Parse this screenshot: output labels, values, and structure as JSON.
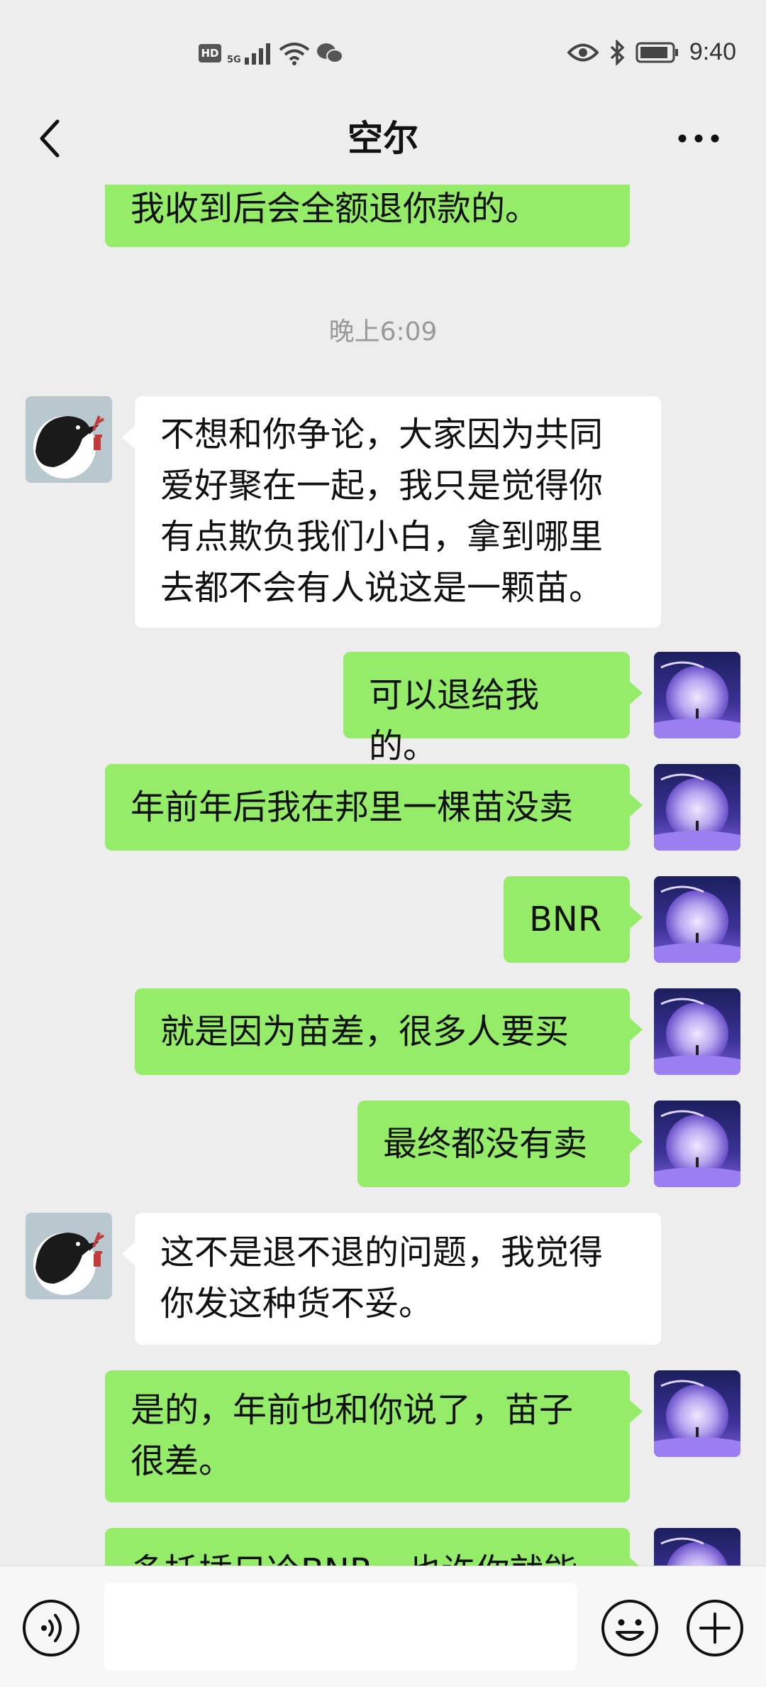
{
  "status_bar": {
    "hd": "HD",
    "network": "5G",
    "time": "9:40",
    "icons": [
      "hd-icon",
      "signal-icon",
      "wifi-icon",
      "wechat-icon",
      "eye-icon",
      "bluetooth-icon",
      "battery-icon"
    ]
  },
  "header": {
    "title": "空尔",
    "back_icon": "chevron-left-icon",
    "more_icon": "more-dots-icon"
  },
  "messages": [
    {
      "side": "right",
      "lines": [
        "我收到后会全额退你款的。"
      ]
    },
    {
      "type": "timestamp",
      "text": "晚上6:09"
    },
    {
      "side": "left",
      "lines": [
        "不想和你争论，大家因为共同",
        "爱好聚在一起，我只是觉得你",
        "有点欺负我们小白，拿到哪里",
        "去都不会有人说这是一颗苗。"
      ]
    },
    {
      "side": "right",
      "lines": [
        "可以退给我的。"
      ]
    },
    {
      "side": "right",
      "lines": [
        "年前年后我在邦里一棵苗没卖"
      ]
    },
    {
      "side": "right",
      "lines": [
        "BNR"
      ]
    },
    {
      "side": "right",
      "lines": [
        "就是因为苗差，很多人要买"
      ]
    },
    {
      "side": "right",
      "lines": [
        "最终都没有卖"
      ]
    },
    {
      "side": "left",
      "lines": [
        "这不是退不退的问题，我觉得",
        "你发这种货不妥。"
      ]
    },
    {
      "side": "right",
      "lines": [
        "是的，年前也和你说了，苗子",
        "很差。"
      ]
    },
    {
      "side": "right",
      "lines": [
        "多托插只冷BNR，也许你就能"
      ]
    }
  ],
  "input_bar": {
    "voice_icon": "voice-icon",
    "input_value": "",
    "emoji_icon": "emoji-icon",
    "plus_icon": "plus-icon"
  },
  "colors": {
    "background": "#ededed",
    "bubble_me": "#95ec69",
    "bubble_other": "#ffffff"
  }
}
